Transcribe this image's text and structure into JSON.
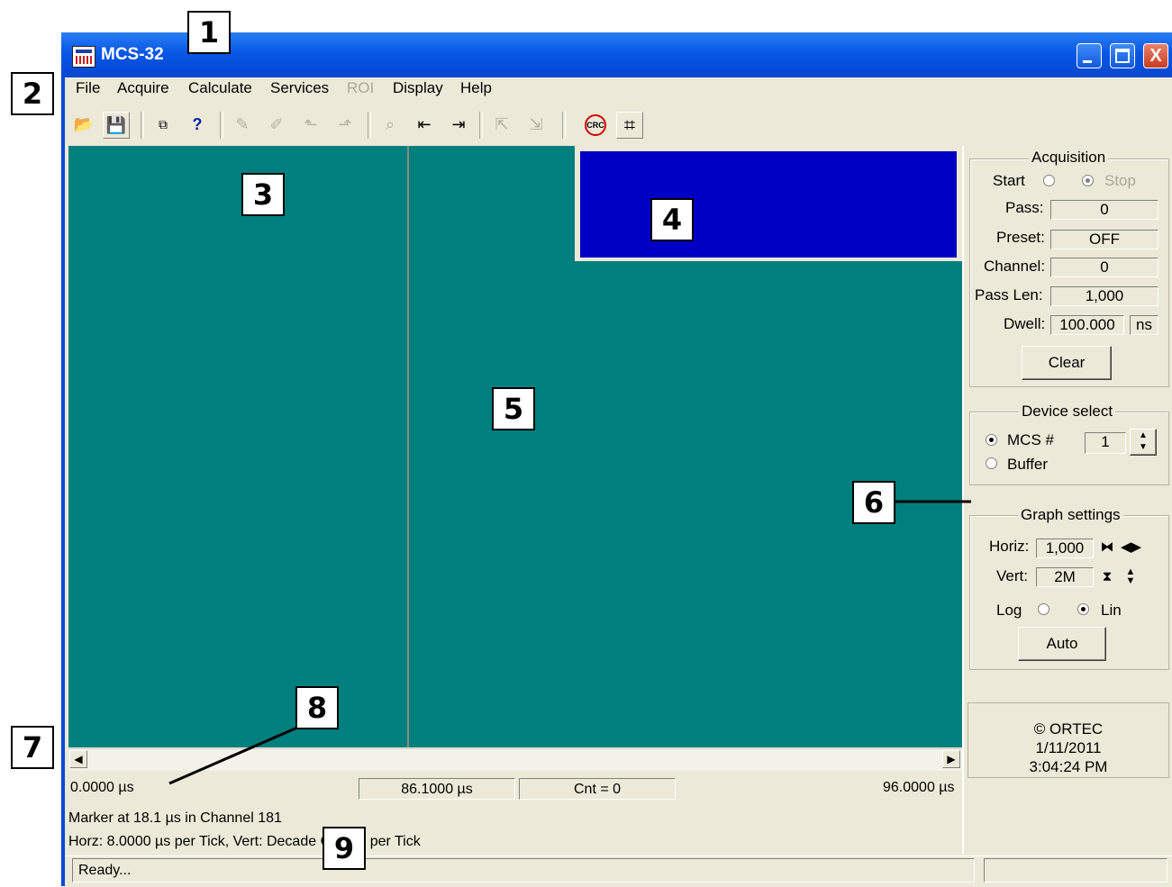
{
  "window": {
    "title": "MCS-32",
    "min_glyph": "_",
    "max_glyph": "□",
    "close_glyph": "X"
  },
  "menu": [
    "File",
    "Acquire",
    "Calculate",
    "Services",
    "ROI",
    "Display",
    "Help"
  ],
  "toolbar": {
    "icons": [
      "open-file-icon",
      "save-icon",
      "compare-icon",
      "help-icon",
      "mark-roi-icon",
      "clear-roi-icon",
      "roi-up-icon",
      "roi-down-icon",
      "peak-info-icon",
      "marker-left-icon",
      "marker-right-icon",
      "roi-prev-icon",
      "roi-next-icon",
      "no-crc-icon",
      "zoom-box-icon"
    ],
    "crc_label": "CRC"
  },
  "graph": {
    "scroll_left": "◀",
    "scroll_right": "▶",
    "left_limit": "0.0000 µs",
    "marker_time": "86.1000 µs",
    "count": "Cnt = 0",
    "right_limit": "96.0000 µs",
    "marker_info": "Marker at 18.1 µs in Channel 181",
    "scale_info": "Horz: 8.0000 µs per Tick, Vert: Decade Counts per Tick"
  },
  "acquisition": {
    "title": "Acquisition",
    "start_label": "Start",
    "stop_label": "Stop",
    "pass_label": "Pass:",
    "pass_value": "0",
    "preset_label": "Preset:",
    "preset_value": "OFF",
    "channel_label": "Channel:",
    "channel_value": "0",
    "pass_len_label": "Pass Len:",
    "pass_len_value": "1,000",
    "dwell_label": "Dwell:",
    "dwell_value": "100.000",
    "dwell_unit": "ns",
    "clear_label": "Clear"
  },
  "device": {
    "title": "Device select",
    "mcs_label": "MCS #",
    "mcs_value": "1",
    "buffer_label": "Buffer"
  },
  "graph_settings": {
    "title": "Graph settings",
    "horiz_label": "Horiz:",
    "horiz_value": "1,000",
    "vert_label": "Vert:",
    "vert_value": "2M",
    "log_label": "Log",
    "lin_label": "Lin",
    "auto_label": "Auto"
  },
  "info": {
    "copyright": "© ORTEC",
    "date": "1/11/2011",
    "time": "3:04:24 PM"
  },
  "status": {
    "text": "Ready..."
  },
  "callouts": [
    "1",
    "2",
    "3",
    "4",
    "5",
    "6",
    "7",
    "8",
    "9"
  ],
  "colors": {
    "graph_bg": "#007f7f",
    "roi_panel": "#0000c4",
    "titlebar": "#0a5ae6",
    "chrome": "#ece9d8"
  }
}
